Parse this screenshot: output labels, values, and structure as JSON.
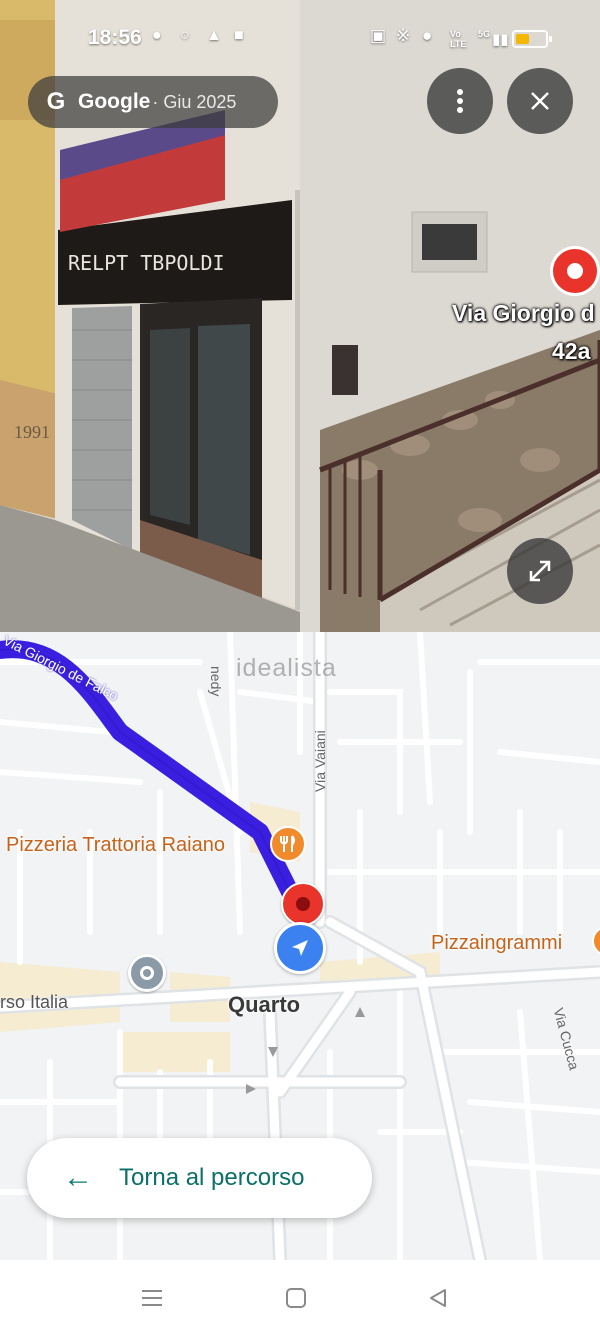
{
  "status_bar": {
    "time": "18:56",
    "volte_top": "Vo",
    "volte_bottom": "LTE",
    "network": "5G",
    "battery_level": 0.45,
    "battery_color": "#f5b800"
  },
  "street_view": {
    "brand": "Google",
    "date": "· Giu 2025",
    "address_line1": "Via Giorgio d",
    "address_line2": "42a",
    "more_icon": "more-vert-icon",
    "close_icon": "close-icon",
    "expand_icon": "expand-icon"
  },
  "map": {
    "watermark": "idealista",
    "route_street": "Via Giorgio de Falco",
    "poi_restaurant": "Pizzeria Trattoria Raiano",
    "poi_pizza": "Pizzaingrammi",
    "town": "Quarto",
    "street_corso": "rso Italia",
    "street_vaiani": "Via Vaiani",
    "street_nedy": "nedy",
    "street_cucca": "Via Cucca",
    "route_color": "#3b1fe0",
    "return_button_label": "Torna al percorso"
  },
  "navbar": {
    "menu_icon": "menu-icon",
    "home_icon": "home-icon",
    "back_icon": "back-icon"
  }
}
